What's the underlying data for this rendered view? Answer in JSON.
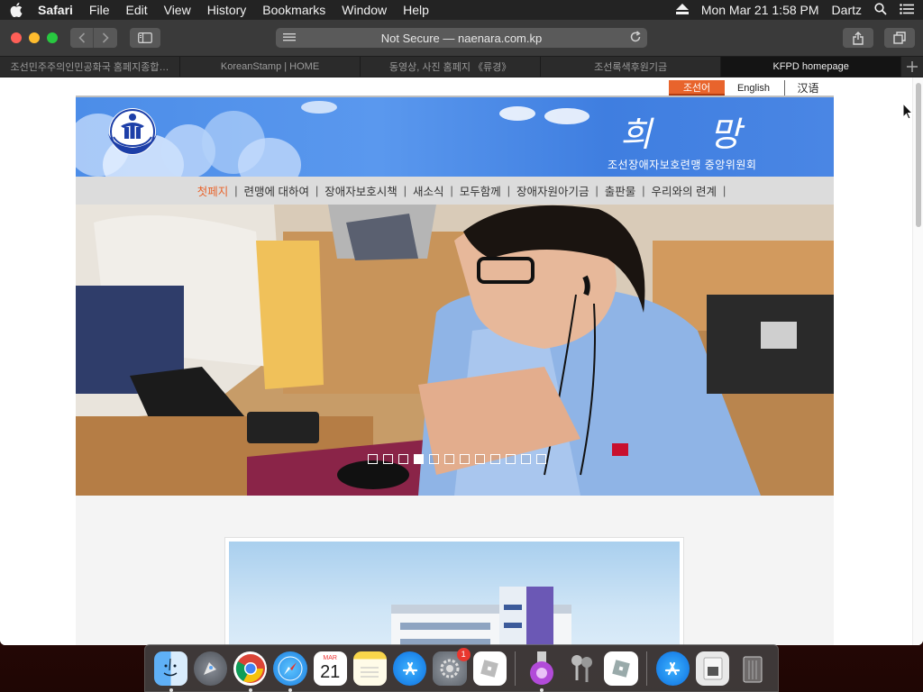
{
  "menubar": {
    "app": "Safari",
    "items": [
      "File",
      "Edit",
      "View",
      "History",
      "Bookmarks",
      "Window",
      "Help"
    ],
    "clock": "Mon Mar 21  1:58 PM",
    "user": "Dartz"
  },
  "toolbar": {
    "address": "Not Secure — naenara.com.kp"
  },
  "tabs": [
    {
      "label": "조선민주주의인민공화국 홈페지종합…",
      "active": false
    },
    {
      "label": "KoreanStamp | HOME",
      "active": false
    },
    {
      "label": "동영상, 사진 홈페지 《류경》",
      "active": false
    },
    {
      "label": "조선록색후원기금",
      "active": false
    },
    {
      "label": "KFPD homepage",
      "active": true
    }
  ],
  "site": {
    "languages": {
      "korean": "조선어",
      "english": "English",
      "chinese": "汉语"
    },
    "banner": {
      "title": "희 망",
      "subtitle": "조선장애자보호련맹 중앙위원회"
    },
    "nav": [
      "첫페지",
      "련맹에 대하여",
      "장애자보호시책",
      "새소식",
      "모두함께",
      "장애자원아기금",
      "출판물",
      "우리와의 련계"
    ],
    "active_nav": "첫페지",
    "slider": {
      "total": 12,
      "current": 4
    }
  },
  "dock": {
    "calendar_month": "MAR",
    "calendar_day": "21",
    "badge_count": "1",
    "apps": [
      "finder-icon",
      "launchpad-icon",
      "chrome-icon",
      "safari-icon",
      "calendar-icon",
      "notes-icon",
      "app-store-icon",
      "system-preferences-icon",
      "roblox-icon",
      "camo-icon",
      "keychain-icon",
      "roblox-studio-icon",
      "app-store-2-icon",
      "disk-utility-icon",
      "trash-icon"
    ]
  }
}
